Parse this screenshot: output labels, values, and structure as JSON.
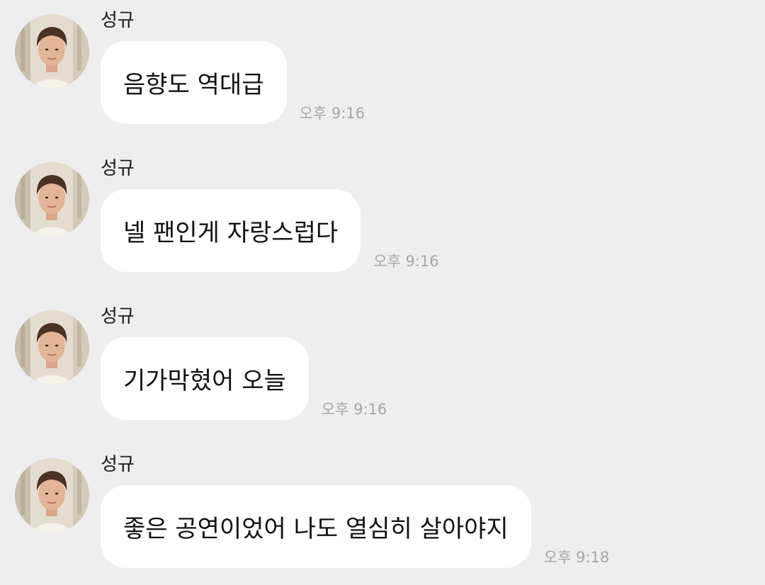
{
  "messages": [
    {
      "sender": "성규",
      "text": "음향도 역대급",
      "time": "오후 9:16",
      "avatar": "profile-photo"
    },
    {
      "sender": "성규",
      "text": "넬 팬인게 자랑스럽다",
      "time": "오후 9:16",
      "avatar": "profile-photo"
    },
    {
      "sender": "성규",
      "text": "기가막혔어 오늘",
      "time": "오후 9:16",
      "avatar": "profile-photo"
    },
    {
      "sender": "성규",
      "text": "좋은 공연이었어 나도 열심히 살아야지",
      "time": "오후 9:18",
      "avatar": "profile-photo"
    }
  ],
  "colors": {
    "background": "#eeeeee",
    "bubble": "#ffffff",
    "timestamp": "#a6a6a6",
    "text": "#111111"
  }
}
